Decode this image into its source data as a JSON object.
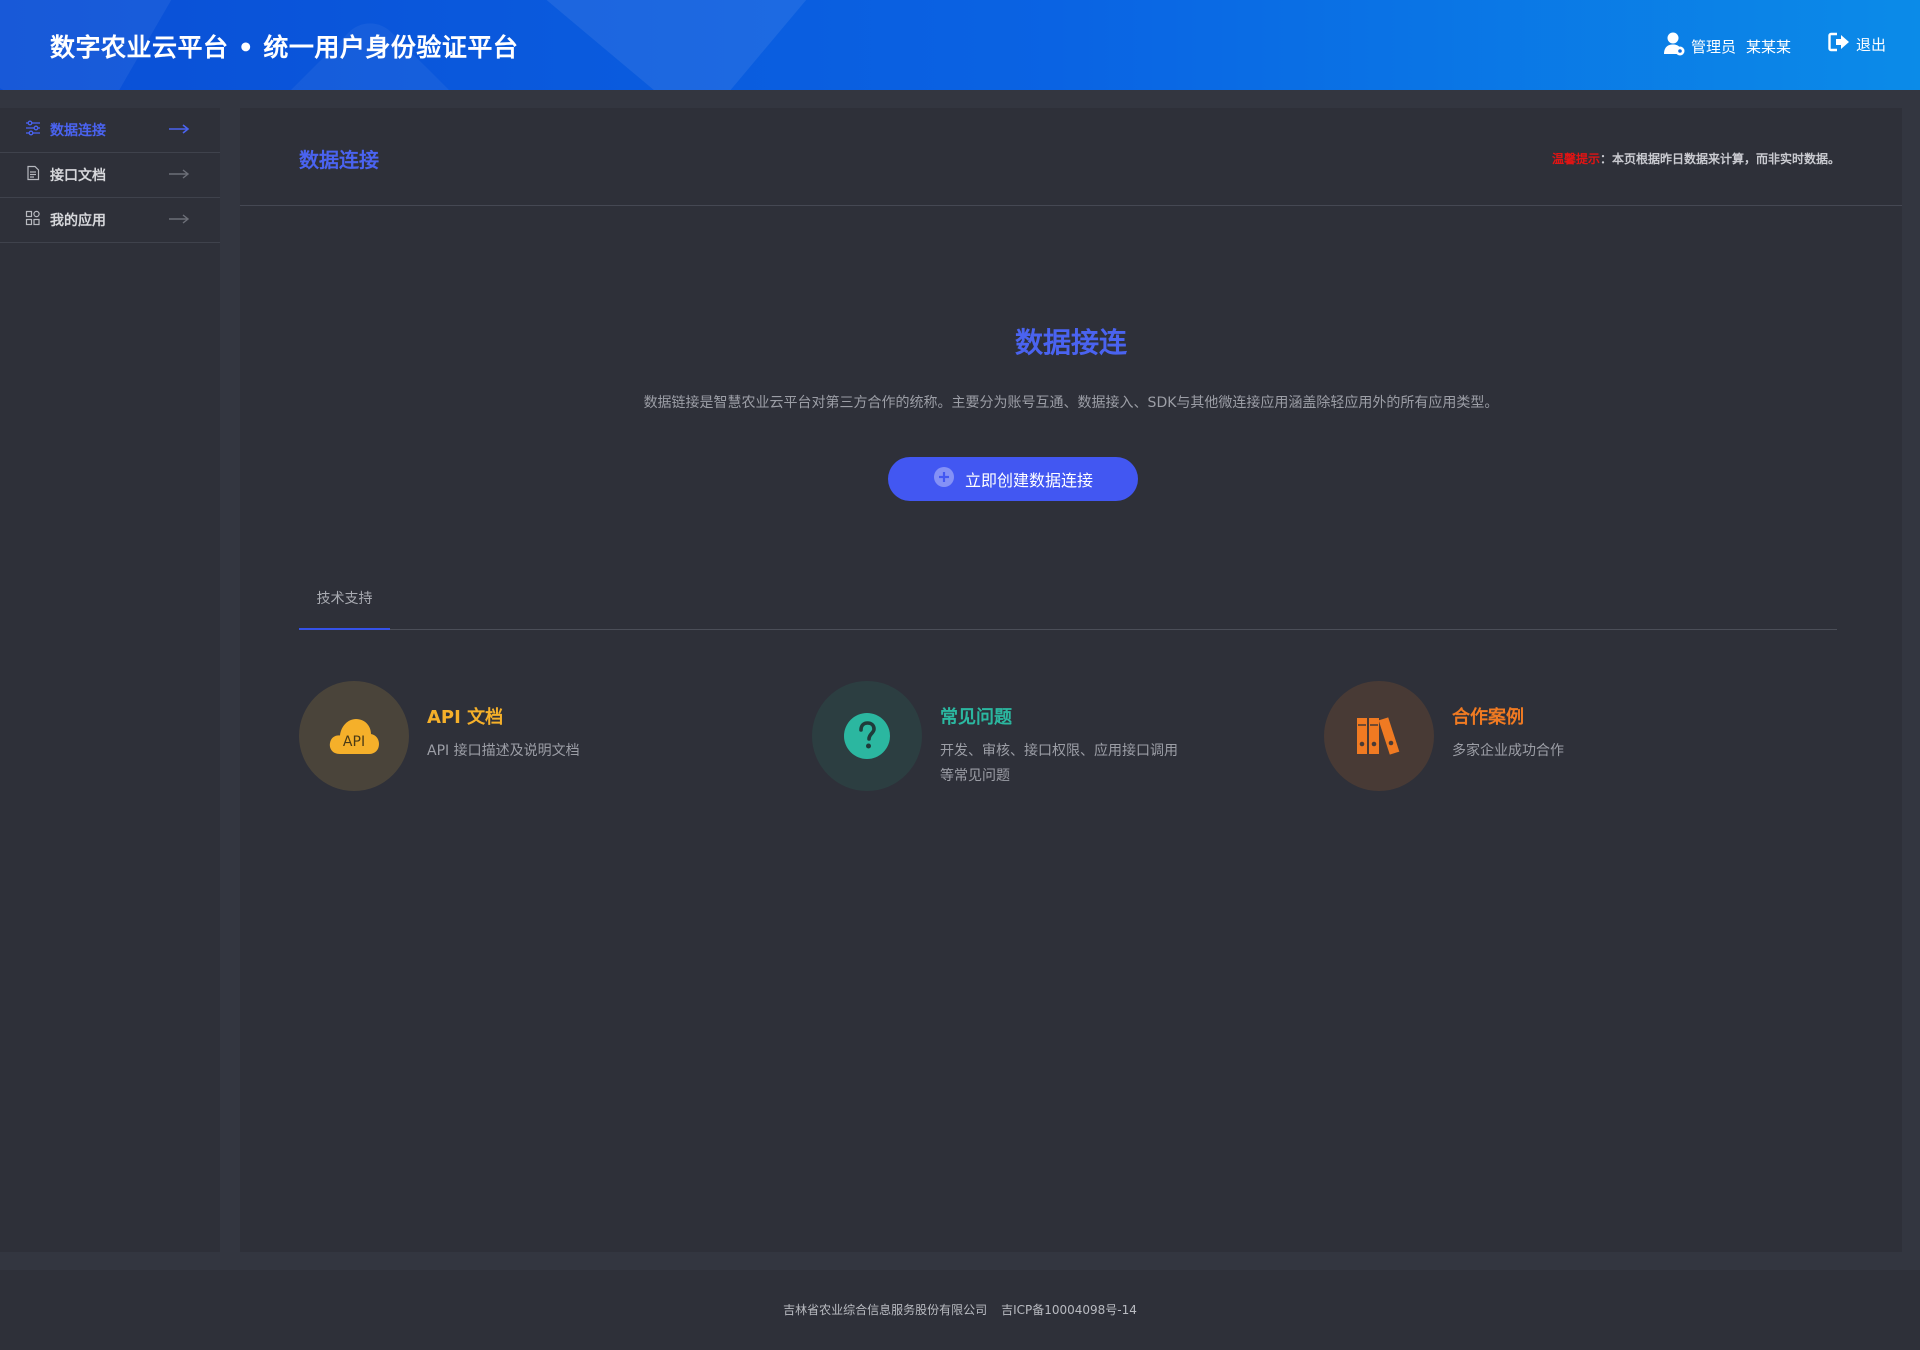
{
  "header": {
    "title": "数字农业云平台 • 统一用户身份验证平台",
    "user_role": "管理员",
    "user_name": "某某某",
    "logout_label": "退出"
  },
  "sidebar": {
    "items": [
      {
        "label": "数据连接",
        "icon": "sliders-icon",
        "active": true
      },
      {
        "label": "接口文档",
        "icon": "document-icon",
        "active": false
      },
      {
        "label": "我的应用",
        "icon": "apps-grid-icon",
        "active": false
      }
    ]
  },
  "main": {
    "page_title": "数据连接",
    "notice_warn": "温馨提示",
    "notice_text": "：本页根据昨日数据来计算，而非实时数据。",
    "hero_title": "数据接连",
    "hero_desc": "数据链接是智慧农业云平台对第三方合作的统称。主要分为账号互通、数据接入、SDK与其他微连接应用涵盖除轻应用外的所有应用类型。",
    "create_button": "立即创建数据连接",
    "tabs": [
      {
        "label": "技术支持",
        "active": true
      }
    ],
    "cards": [
      {
        "title": "API 文档",
        "desc": "API 接口描述及说明文档",
        "icon": "api-cloud-icon",
        "color": "#f5b02a"
      },
      {
        "title": "常见问题",
        "desc": "开发、审核、接口权限、应用接口调用等常见问题",
        "icon": "question-icon",
        "color": "#2bb7a0"
      },
      {
        "title": "合作案例",
        "desc": "多家企业成功合作",
        "icon": "books-icon",
        "color": "#f07a22"
      }
    ],
    "api_icon_text": "API"
  },
  "footer": {
    "company": "吉林省农业综合信息服务股份有限公司",
    "icp": "吉ICP备10004098号-14"
  },
  "colors": {
    "accent": "#4a63f0",
    "header_start": "#0a4fd6",
    "header_end": "#0b8be8",
    "background": "#333640",
    "panel": "#2e3039",
    "warn": "#e01414"
  }
}
